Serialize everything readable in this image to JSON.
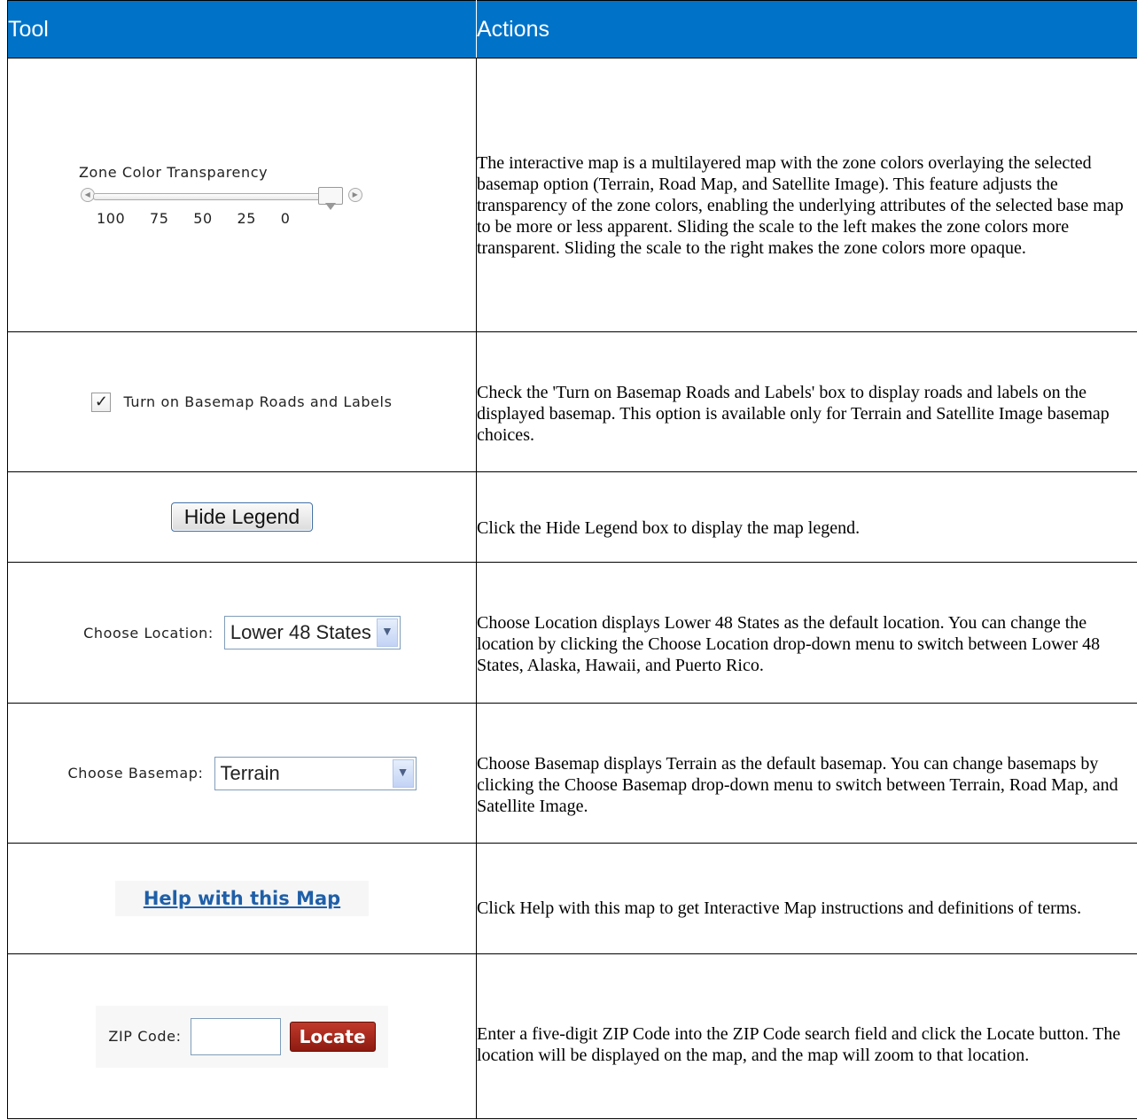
{
  "header": {
    "tool": "Tool",
    "actions": "Actions"
  },
  "rows": [
    {
      "slider": {
        "title": "Zone Color Transparency",
        "ticks": [
          "100",
          "75",
          "50",
          "25",
          "0"
        ]
      },
      "action": "The interactive map is a multilayered map with the zone colors overlaying the selected basemap option (Terrain, Road Map, and Satellite Image). This feature adjusts the transparency of the zone colors, enabling the underlying attributes of the selected base map to be more or less apparent. Sliding the scale to the left makes the zone colors more transparent. Sliding the scale to the right makes the zone colors more opaque."
    },
    {
      "checkbox_label": "Turn on Basemap Roads and Labels",
      "action": "Check the 'Turn on Basemap Roads and Labels' box to display roads and labels on the displayed basemap. This option is available only for Terrain and Satellite Image basemap choices."
    },
    {
      "button_label": "Hide Legend",
      "action": "Click the Hide Legend box to display the map legend."
    },
    {
      "label": "Choose Location:",
      "value": "Lower 48 States",
      "action": "Choose Location displays Lower 48 States as the default location. You can change the location by clicking the Choose Location drop-down menu to switch between Lower 48 States, Alaska, Hawaii, and Puerto Rico."
    },
    {
      "label": "Choose Basemap:",
      "value": "Terrain",
      "action": "Choose Basemap displays Terrain as the default basemap. You can change basemaps by clicking the Choose Basemap drop-down menu to switch between Terrain, Road Map, and Satellite Image."
    },
    {
      "link_label": "Help with this Map",
      "action": "Click Help with this map to get Interactive Map instructions and definitions of terms."
    },
    {
      "label": "ZIP Code:",
      "button_label": "Locate",
      "action": "Enter a five-digit ZIP Code into the ZIP Code search field and click the Locate button. The location will be displayed on the map, and the map will zoom to that location."
    }
  ]
}
